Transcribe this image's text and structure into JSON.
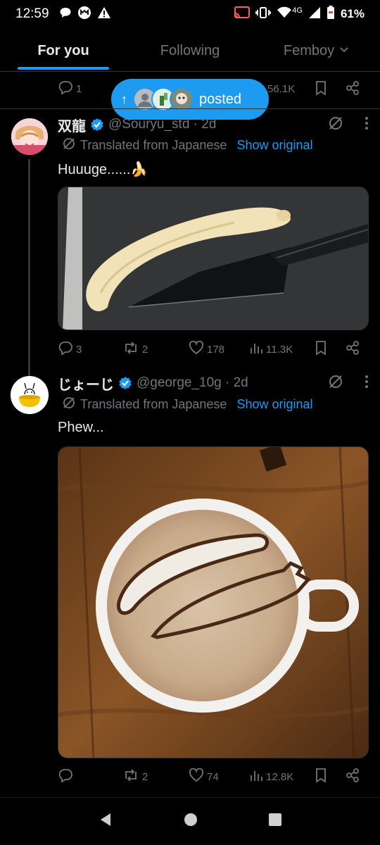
{
  "status_bar": {
    "time": "12:59",
    "network": "4G",
    "battery": "61%",
    "icons": [
      "chat-bubble-icon",
      "app-m-icon",
      "warning-icon",
      "cast-icon",
      "vibrate-icon",
      "wifi-icon",
      "signal-icon",
      "battery-icon"
    ]
  },
  "tabs": [
    {
      "label": "For you",
      "active": true
    },
    {
      "label": "Following",
      "active": false
    },
    {
      "label": "Femboy",
      "active": false
    }
  ],
  "previous_post": {
    "replies": "1",
    "views": "56.1K"
  },
  "posted_pill": {
    "label": "posted"
  },
  "posts": [
    {
      "display_name": "双龍",
      "handle": "@Souryu_std · 2d",
      "translated_label": "Translated from Japanese",
      "show_original": "Show original",
      "text": "Huuuge......🍌",
      "replies": "3",
      "reposts": "2",
      "likes": "178",
      "views": "11.3K"
    },
    {
      "display_name": "じょーじ",
      "handle": "@george_10g · 2d",
      "translated_label": "Translated from Japanese",
      "show_original": "Show original",
      "text": "Phew...",
      "replies": "",
      "reposts": "2",
      "likes": "74",
      "views": "12.8K"
    }
  ],
  "colors": {
    "accent": "#1d9bf0",
    "muted": "#71767b",
    "text": "#e7e9ea",
    "background": "#000000"
  }
}
